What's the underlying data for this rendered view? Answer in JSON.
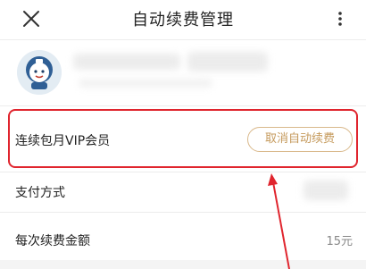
{
  "header": {
    "title": "自动续费管理"
  },
  "subscription": {
    "label": "连续包月VIP会员",
    "cancel_label": "取消自动续费"
  },
  "payment": {
    "label": "支付方式"
  },
  "renewal": {
    "label": "每次续费金额",
    "amount": "15元"
  },
  "colors": {
    "annotation_red": "#e0252e",
    "button_gold": "#c59a5c",
    "button_border": "#d9b88a"
  },
  "icons": {
    "close": "close-icon",
    "more": "more-vertical-icon",
    "avatar": "avatar-icon"
  }
}
